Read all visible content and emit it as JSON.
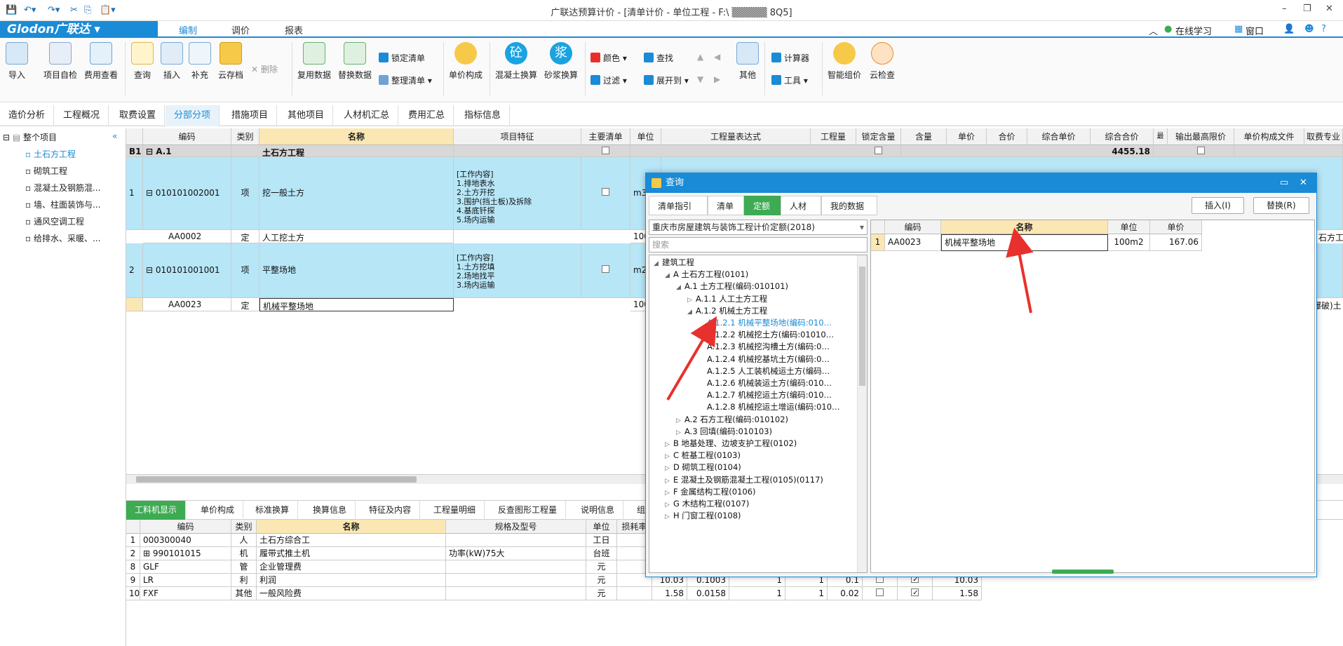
{
  "window": {
    "title": "广联达预算计价 - [清单计价 - 单位工程 - F:\\ ▒▒▒▒▒ 8Q5]"
  },
  "menubar": {
    "logo": "Glodon广联达",
    "menus": [
      "编制",
      "调价",
      "报表"
    ],
    "right": [
      "在线学习",
      "窗口"
    ]
  },
  "ribbon": {
    "big": [
      "导入",
      "项目自检",
      "费用查看",
      "查询",
      "插入",
      "补充",
      "云存档",
      "复用数据",
      "替换数据",
      "单价构成",
      "混凝土换算",
      "砂浆换算",
      "其他",
      "智能组价",
      "云检查"
    ],
    "small": {
      "delete": "删除",
      "lock": "锁定清单",
      "organize": "整理清单",
      "color": "颜色",
      "find": "查找",
      "filter": "过滤",
      "expand": "展开到",
      "calc": "计算器",
      "tools": "工具",
      "concrete_char": "砼",
      "mortar_char": "浆"
    }
  },
  "tabs": [
    "造价分析",
    "工程概况",
    "取费设置",
    "分部分项",
    "措施项目",
    "其他项目",
    "人材机汇总",
    "费用汇总",
    "指标信息"
  ],
  "tree": {
    "root": "整个项目",
    "items": [
      "土石方工程",
      "砌筑工程",
      "混凝土及钢筋混...",
      "墙、柱面装饰与...",
      "通风空调工程",
      "给排水、采暖、..."
    ]
  },
  "grid": {
    "headers": [
      "编码",
      "类别",
      "名称",
      "项目特征",
      "主要清单",
      "单位",
      "工程量表达式",
      "工程量",
      "锁定含量",
      "含量",
      "单价",
      "合价",
      "综合单价",
      "综合合价",
      "最高",
      "输出最高限价",
      "单价构成文件",
      "取费专业"
    ],
    "rows": {
      "b1": {
        "no": "B1",
        "code": "A.1",
        "name": "土石方工程",
        "total": "4455.18"
      },
      "r1": {
        "no": "1",
        "code": "010101002001",
        "type": "项",
        "name": "挖一般土方",
        "feat": "[工作内容]\n1.排地表水\n2.土方开挖\n3.围护(挡土板)及拆除\n4.基底钎探\n5.场内运输",
        "unit": "m3"
      },
      "r1a": {
        "code": "AA0002",
        "type": "定",
        "name": "人工挖土方",
        "unit": "100"
      },
      "r2": {
        "no": "2",
        "code": "010101001001",
        "type": "项",
        "name": "平整场地",
        "feat": "[工作内容]\n1.土方挖填\n2.场地找平\n3.场内运输",
        "unit": "m2"
      },
      "r2a": {
        "code": "AA0023",
        "type": "定",
        "name": "机械平整场地",
        "unit": "100"
      }
    },
    "right_cut": {
      "a": "石方工",
      "b": "爆破)土"
    }
  },
  "lower_tabs": [
    "工料机显示",
    "单价构成",
    "标准换算",
    "换算信息",
    "特征及内容",
    "工程量明细",
    "反查图形工程量",
    "说明信息",
    "组"
  ],
  "lower_grid": {
    "headers": [
      "编码",
      "类别",
      "名称",
      "规格及型号",
      "单位",
      "损耗率"
    ],
    "rows": [
      {
        "no": "1",
        "code": "000300040",
        "type": "人",
        "name": "土石方综合工",
        "spec": "",
        "unit": "工日",
        "v": []
      },
      {
        "no": "2",
        "code": "990101015",
        "type": "机",
        "name": "履带式推土机",
        "spec": "功率(kW)75大",
        "unit": "台班",
        "v": []
      },
      {
        "no": "8",
        "code": "GLF",
        "type": "管",
        "name": "企业管理费",
        "spec": "",
        "unit": "元",
        "v": []
      },
      {
        "no": "9",
        "code": "LR",
        "type": "利",
        "name": "利润",
        "spec": "",
        "unit": "元",
        "v": [
          "10.03",
          "0.1003",
          "1",
          "1",
          "0.1",
          "10.03"
        ]
      },
      {
        "no": "10",
        "code": "FXF",
        "type": "其他",
        "name": "一般风险费",
        "spec": "",
        "unit": "元",
        "v": [
          "1.58",
          "0.0158",
          "1",
          "1",
          "0.02",
          "1.58"
        ]
      }
    ]
  },
  "dialog": {
    "title": "查询",
    "tabs": [
      "清单指引",
      "清单",
      "定额",
      "人材机",
      "我的数据"
    ],
    "insert": "插入(I)",
    "replace": "替换(R)",
    "library": "重庆市房屋建筑与装饰工程计价定额(2018)",
    "search_placeholder": "搜索",
    "tree": [
      "建筑工程",
      "A 土石方工程(0101)",
      "A.1 土方工程(编码:010101)",
      "A.1.1 人工土方工程",
      "A.1.2 机械土方工程",
      "A.1.2.1 机械平整场地(编码:010…",
      "A.1.2.2 机械挖土方(编码:01010…",
      "A.1.2.3 机械挖沟槽土方(编码:0…",
      "A.1.2.4 机械挖基坑土方(编码:0…",
      "A.1.2.5 人工装机械运土方(编码…",
      "A.1.2.6 机械装运土方(编码:010…",
      "A.1.2.7 机械挖运土方(编码:010…",
      "A.1.2.8 机械挖运土增运(编码:010…",
      "A.2 石方工程(编码:010102)",
      "A.3 回填(编码:010103)",
      "B 地基处理、边坡支护工程(0102)",
      "C 桩基工程(0103)",
      "D 砌筑工程(0104)",
      "E 混凝土及钢筋混凝土工程(0105)(0117)",
      "F 金属结构工程(0106)",
      "G 木结构工程(0107)",
      "H 门窗工程(0108)"
    ],
    "list_headers": [
      "编码",
      "名称",
      "单位",
      "单价"
    ],
    "list_rows": [
      {
        "no": "1",
        "code": "AA0023",
        "name": "机械平整场地",
        "unit": "100m2",
        "price": "167.06"
      }
    ]
  },
  "colors": {
    "accent": "#1a8bd6",
    "green": "#3dab52",
    "row_blue": "#b7e6f7",
    "arrow": "#e8312c"
  }
}
